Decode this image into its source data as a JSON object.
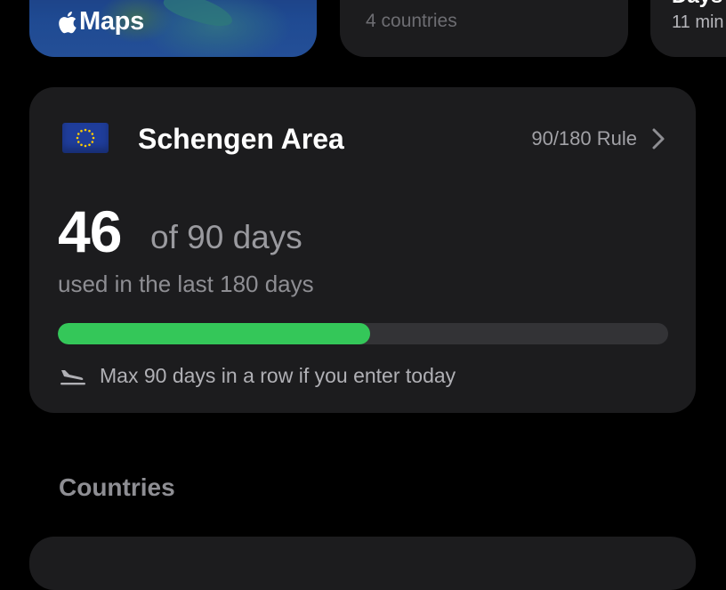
{
  "top_cards": {
    "maps": {
      "label": "Maps"
    },
    "countries": {
      "subtitle": "4 countries"
    },
    "days": {
      "title": "Days",
      "subtitle": "11 min"
    }
  },
  "schengen": {
    "flag": "eu-flag-icon",
    "title": "Schengen Area",
    "rule_link": "90/180 Rule",
    "used_days": "46",
    "of_total": "of 90 days",
    "period_text": "used in the last 180 days",
    "progress_fraction": 0.511,
    "max_stay_text": "Max 90 days in a row if you enter today",
    "colors": {
      "progress": "#34c759",
      "track": "#333336"
    }
  },
  "sections": {
    "countries_title": "Countries"
  }
}
